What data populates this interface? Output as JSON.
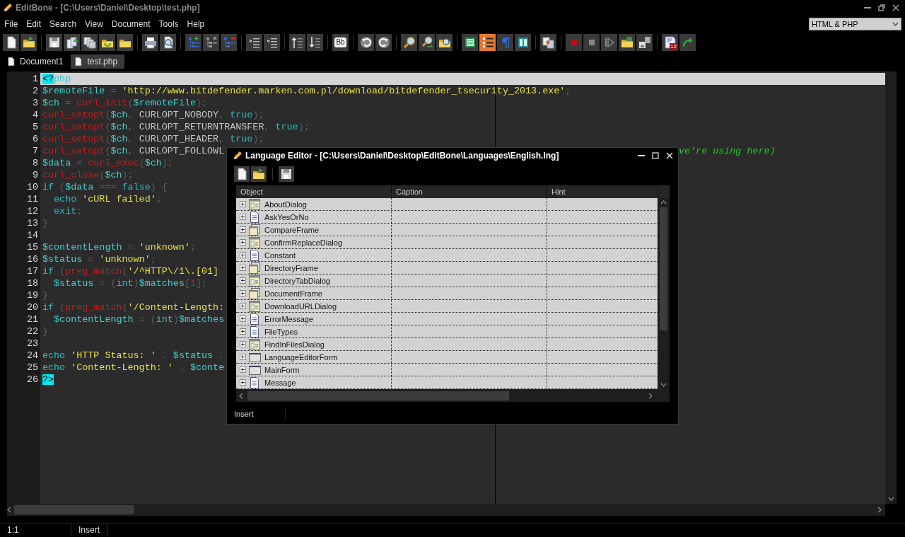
{
  "window": {
    "title": "EditBone - [C:\\Users\\Daniel\\Desktop\\test.php]"
  },
  "menu": [
    "File",
    "Edit",
    "Search",
    "View",
    "Document",
    "Tools",
    "Help"
  ],
  "highlighter": {
    "value": "HTML & PHP"
  },
  "toolbar": [
    {
      "buttons": [
        {
          "kind": "new",
          "on": false
        },
        {
          "kind": "open",
          "on": false
        }
      ]
    },
    {
      "buttons": [
        {
          "kind": "save",
          "on": false
        },
        {
          "kind": "save-all",
          "on": false
        },
        {
          "kind": "duplicate",
          "on": false
        },
        {
          "kind": "folder-refresh",
          "on": false
        },
        {
          "kind": "folder",
          "on": false
        }
      ]
    },
    {
      "buttons": [
        {
          "kind": "print",
          "on": false
        },
        {
          "kind": "preview",
          "on": false
        }
      ]
    },
    {
      "buttons": [
        {
          "kind": "tree-add",
          "on": false
        },
        {
          "kind": "tree-remove",
          "on": false
        },
        {
          "kind": "tree-mark",
          "on": false
        }
      ]
    },
    {
      "buttons": [
        {
          "kind": "indent",
          "on": false
        },
        {
          "kind": "outdent",
          "on": false
        }
      ]
    },
    {
      "buttons": [
        {
          "kind": "sort-up",
          "on": false
        },
        {
          "kind": "sort-down",
          "on": false
        }
      ]
    },
    {
      "buttons": [
        {
          "kind": "case",
          "label": "Bb",
          "on": false
        }
      ]
    },
    {
      "buttons": [
        {
          "kind": "undo",
          "on": false
        },
        {
          "kind": "redo",
          "on": false
        }
      ]
    },
    {
      "buttons": [
        {
          "kind": "search",
          "on": false
        },
        {
          "kind": "replace",
          "on": false
        },
        {
          "kind": "find-files",
          "on": false
        }
      ]
    },
    {
      "buttons": [
        {
          "kind": "list",
          "on": false
        },
        {
          "kind": "numbers",
          "on": true
        },
        {
          "kind": "pilcrow",
          "on": false
        },
        {
          "kind": "columns",
          "on": false
        }
      ]
    },
    {
      "buttons": [
        {
          "kind": "compare",
          "on": false
        }
      ]
    },
    {
      "buttons": [
        {
          "kind": "record",
          "on": false
        },
        {
          "kind": "stop",
          "on": false
        },
        {
          "kind": "play",
          "on": false
        },
        {
          "kind": "folder-film",
          "on": false
        },
        {
          "kind": "save-film",
          "on": false
        }
      ]
    },
    {
      "buttons": [
        {
          "kind": "date",
          "label": "12",
          "on": false
        },
        {
          "kind": "arrow",
          "on": false
        }
      ]
    }
  ],
  "tabs": [
    {
      "label": "Document1",
      "selected": false
    },
    {
      "label": "test.php",
      "selected": true
    }
  ],
  "editor": {
    "lines": [
      {
        "number": "1",
        "current": true,
        "tokens": [
          {
            "kind": "tag",
            "text": "<?"
          },
          {
            "kind": "tagname",
            "text": "php"
          }
        ]
      },
      {
        "number": "2",
        "current": false,
        "tokens": [
          {
            "kind": "var",
            "text": "$remoteFile"
          },
          {
            "kind": "op",
            "text": " = "
          },
          {
            "kind": "str",
            "text": "'http://www.bitdefender.marken.com.pl/download/bitdefender_tsecurity_2013.exe'"
          },
          {
            "kind": "op",
            "text": ";"
          }
        ]
      },
      {
        "number": "3",
        "current": false,
        "tokens": [
          {
            "kind": "var",
            "text": "$ch"
          },
          {
            "kind": "op",
            "text": " = "
          },
          {
            "kind": "fn",
            "text": "curl_init"
          },
          {
            "kind": "op",
            "text": "("
          },
          {
            "kind": "var",
            "text": "$remoteFile"
          },
          {
            "kind": "op",
            "text": ");"
          }
        ]
      },
      {
        "number": "4",
        "current": false,
        "tokens": [
          {
            "kind": "fn",
            "text": "curl_setopt"
          },
          {
            "kind": "op",
            "text": "("
          },
          {
            "kind": "var",
            "text": "$ch"
          },
          {
            "kind": "op",
            "text": ", "
          },
          {
            "kind": "const",
            "text": "CURLOPT_NOBODY"
          },
          {
            "kind": "op",
            "text": ", "
          },
          {
            "kind": "kw",
            "text": "true"
          },
          {
            "kind": "op",
            "text": ");"
          }
        ]
      },
      {
        "number": "5",
        "current": false,
        "tokens": [
          {
            "kind": "fn",
            "text": "curl_setopt"
          },
          {
            "kind": "op",
            "text": "("
          },
          {
            "kind": "var",
            "text": "$ch"
          },
          {
            "kind": "op",
            "text": ", "
          },
          {
            "kind": "const",
            "text": "CURLOPT_RETURNTRANSFER"
          },
          {
            "kind": "op",
            "text": ", "
          },
          {
            "kind": "kw",
            "text": "true"
          },
          {
            "kind": "op",
            "text": ");"
          }
        ]
      },
      {
        "number": "6",
        "current": false,
        "tokens": [
          {
            "kind": "fn",
            "text": "curl_setopt"
          },
          {
            "kind": "op",
            "text": "("
          },
          {
            "kind": "var",
            "text": "$ch"
          },
          {
            "kind": "op",
            "text": ", "
          },
          {
            "kind": "const",
            "text": "CURLOPT_HEADER"
          },
          {
            "kind": "op",
            "text": ", "
          },
          {
            "kind": "kw",
            "text": "true"
          },
          {
            "kind": "op",
            "text": ");"
          }
        ]
      },
      {
        "number": "7",
        "current": false,
        "tokens": [
          {
            "kind": "fn",
            "text": "curl_setopt"
          },
          {
            "kind": "op",
            "text": "("
          },
          {
            "kind": "var",
            "text": "$ch"
          },
          {
            "kind": "op",
            "text": ", "
          },
          {
            "kind": "const",
            "text": "CURLOPT_FOLLOWL"
          }
        ],
        "tail": "ve're using here)"
      },
      {
        "number": "8",
        "current": false,
        "tokens": [
          {
            "kind": "var",
            "text": "$data"
          },
          {
            "kind": "op",
            "text": " = "
          },
          {
            "kind": "fn",
            "text": "curl_exec"
          },
          {
            "kind": "op",
            "text": "("
          },
          {
            "kind": "var",
            "text": "$ch"
          },
          {
            "kind": "op",
            "text": ");"
          }
        ]
      },
      {
        "number": "9",
        "current": false,
        "tokens": [
          {
            "kind": "fn",
            "text": "curl_close"
          },
          {
            "kind": "op",
            "text": "("
          },
          {
            "kind": "var",
            "text": "$ch"
          },
          {
            "kind": "op",
            "text": ");"
          }
        ]
      },
      {
        "number": "10",
        "current": false,
        "tokens": [
          {
            "kind": "kw",
            "text": "if"
          },
          {
            "kind": "op",
            "text": " ("
          },
          {
            "kind": "var",
            "text": "$data"
          },
          {
            "kind": "op",
            "text": " === "
          },
          {
            "kind": "kw",
            "text": "false"
          },
          {
            "kind": "op",
            "text": ") {"
          }
        ]
      },
      {
        "number": "11",
        "current": false,
        "tokens": [
          {
            "kind": "kw",
            "text": "  echo"
          },
          {
            "kind": "str",
            "text": " 'cURL failed'"
          },
          {
            "kind": "op",
            "text": ";"
          }
        ]
      },
      {
        "number": "12",
        "current": false,
        "tokens": [
          {
            "kind": "kw",
            "text": "  exit"
          },
          {
            "kind": "op",
            "text": ";"
          }
        ]
      },
      {
        "number": "13",
        "current": false,
        "tokens": [
          {
            "kind": "op",
            "text": "}"
          }
        ]
      },
      {
        "number": "14",
        "current": false
      },
      {
        "number": "15",
        "current": false,
        "tokens": [
          {
            "kind": "var",
            "text": "$contentLength"
          },
          {
            "kind": "op",
            "text": " = "
          },
          {
            "kind": "str",
            "text": "'unknown'"
          },
          {
            "kind": "op",
            "text": ";"
          }
        ]
      },
      {
        "number": "16",
        "current": false,
        "tokens": [
          {
            "kind": "var",
            "text": "$status"
          },
          {
            "kind": "op",
            "text": " = "
          },
          {
            "kind": "str",
            "text": "'unknown'"
          },
          {
            "kind": "op",
            "text": ";"
          }
        ]
      },
      {
        "number": "17",
        "current": false,
        "tokens": [
          {
            "kind": "kw",
            "text": "if"
          },
          {
            "kind": "op",
            "text": " ("
          },
          {
            "kind": "fn",
            "text": "preg_match"
          },
          {
            "kind": "op",
            "text": "("
          },
          {
            "kind": "str",
            "text": "'/^HTTP\\/1\\.[01]"
          }
        ]
      },
      {
        "number": "18",
        "current": false,
        "tokens": [
          {
            "kind": "var",
            "text": "  $status"
          },
          {
            "kind": "op",
            "text": " = ("
          },
          {
            "kind": "kw",
            "text": "int"
          },
          {
            "kind": "op",
            "text": ")"
          },
          {
            "kind": "var",
            "text": "$matches"
          },
          {
            "kind": "op",
            "text": "["
          },
          {
            "kind": "num",
            "text": "1"
          },
          {
            "kind": "op",
            "text": "];"
          }
        ]
      },
      {
        "number": "19",
        "current": false,
        "tokens": [
          {
            "kind": "op",
            "text": "}"
          }
        ]
      },
      {
        "number": "20",
        "current": false,
        "tokens": [
          {
            "kind": "kw",
            "text": "if"
          },
          {
            "kind": "op",
            "text": " ("
          },
          {
            "kind": "fn",
            "text": "preg_match"
          },
          {
            "kind": "op",
            "text": "("
          },
          {
            "kind": "str",
            "text": "'/Content-Length:"
          }
        ]
      },
      {
        "number": "21",
        "current": false,
        "tokens": [
          {
            "kind": "var",
            "text": "  $contentLength"
          },
          {
            "kind": "op",
            "text": " = ("
          },
          {
            "kind": "kw",
            "text": "int"
          },
          {
            "kind": "op",
            "text": ")"
          },
          {
            "kind": "var",
            "text": "$matches"
          }
        ]
      },
      {
        "number": "22",
        "current": false,
        "tokens": [
          {
            "kind": "op",
            "text": "}"
          }
        ]
      },
      {
        "number": "23",
        "current": false
      },
      {
        "number": "24",
        "current": false,
        "tokens": [
          {
            "kind": "kw",
            "text": "echo"
          },
          {
            "kind": "str",
            "text": " 'HTTP Status: '"
          },
          {
            "kind": "op",
            "text": " . "
          },
          {
            "kind": "var",
            "text": "$status"
          },
          {
            "kind": "op",
            "text": " ."
          }
        ]
      },
      {
        "number": "25",
        "current": false,
        "tokens": [
          {
            "kind": "kw",
            "text": "echo"
          },
          {
            "kind": "str",
            "text": " 'Content-Length: '"
          },
          {
            "kind": "op",
            "text": " . "
          },
          {
            "kind": "var",
            "text": "$conte"
          }
        ]
      },
      {
        "number": "26",
        "current": false,
        "tokens": [
          {
            "kind": "tag",
            "text": "?>"
          }
        ]
      }
    ]
  },
  "status_bar": [
    "1:1",
    "Insert"
  ],
  "dialog": {
    "title": "Language Editor - [C:\\Users\\Daniel\\Desktop\\EditBone\\Languages\\English.lng]",
    "toolbar": [
      {
        "kind": "new"
      },
      {
        "kind": "open"
      },
      {
        "kind": "save"
      }
    ],
    "columns": [
      "Object",
      "Caption",
      "Hint"
    ],
    "rows": [
      {
        "name": "AboutDialog",
        "kind": "dialog"
      },
      {
        "name": "AskYesOrNo",
        "kind": "page"
      },
      {
        "name": "CompareFrame",
        "kind": "frame"
      },
      {
        "name": "ConfirmReplaceDialog",
        "kind": "dialog"
      },
      {
        "name": "Constant",
        "kind": "page"
      },
      {
        "name": "DirectoryFrame",
        "kind": "frame"
      },
      {
        "name": "DirectoryTabDialog",
        "kind": "dialog"
      },
      {
        "name": "DocumentFrame",
        "kind": "frame"
      },
      {
        "name": "DownloadURLDialog",
        "kind": "dialog"
      },
      {
        "name": "ErrorMessage",
        "kind": "page"
      },
      {
        "name": "FileTypes",
        "kind": "page"
      },
      {
        "name": "FindInFilesDialog",
        "kind": "dialog"
      },
      {
        "name": "LanguageEditorForm",
        "kind": "form"
      },
      {
        "name": "MainForm",
        "kind": "form"
      },
      {
        "name": "Message",
        "kind": "page"
      }
    ],
    "status_bar": [
      "Insert"
    ]
  }
}
